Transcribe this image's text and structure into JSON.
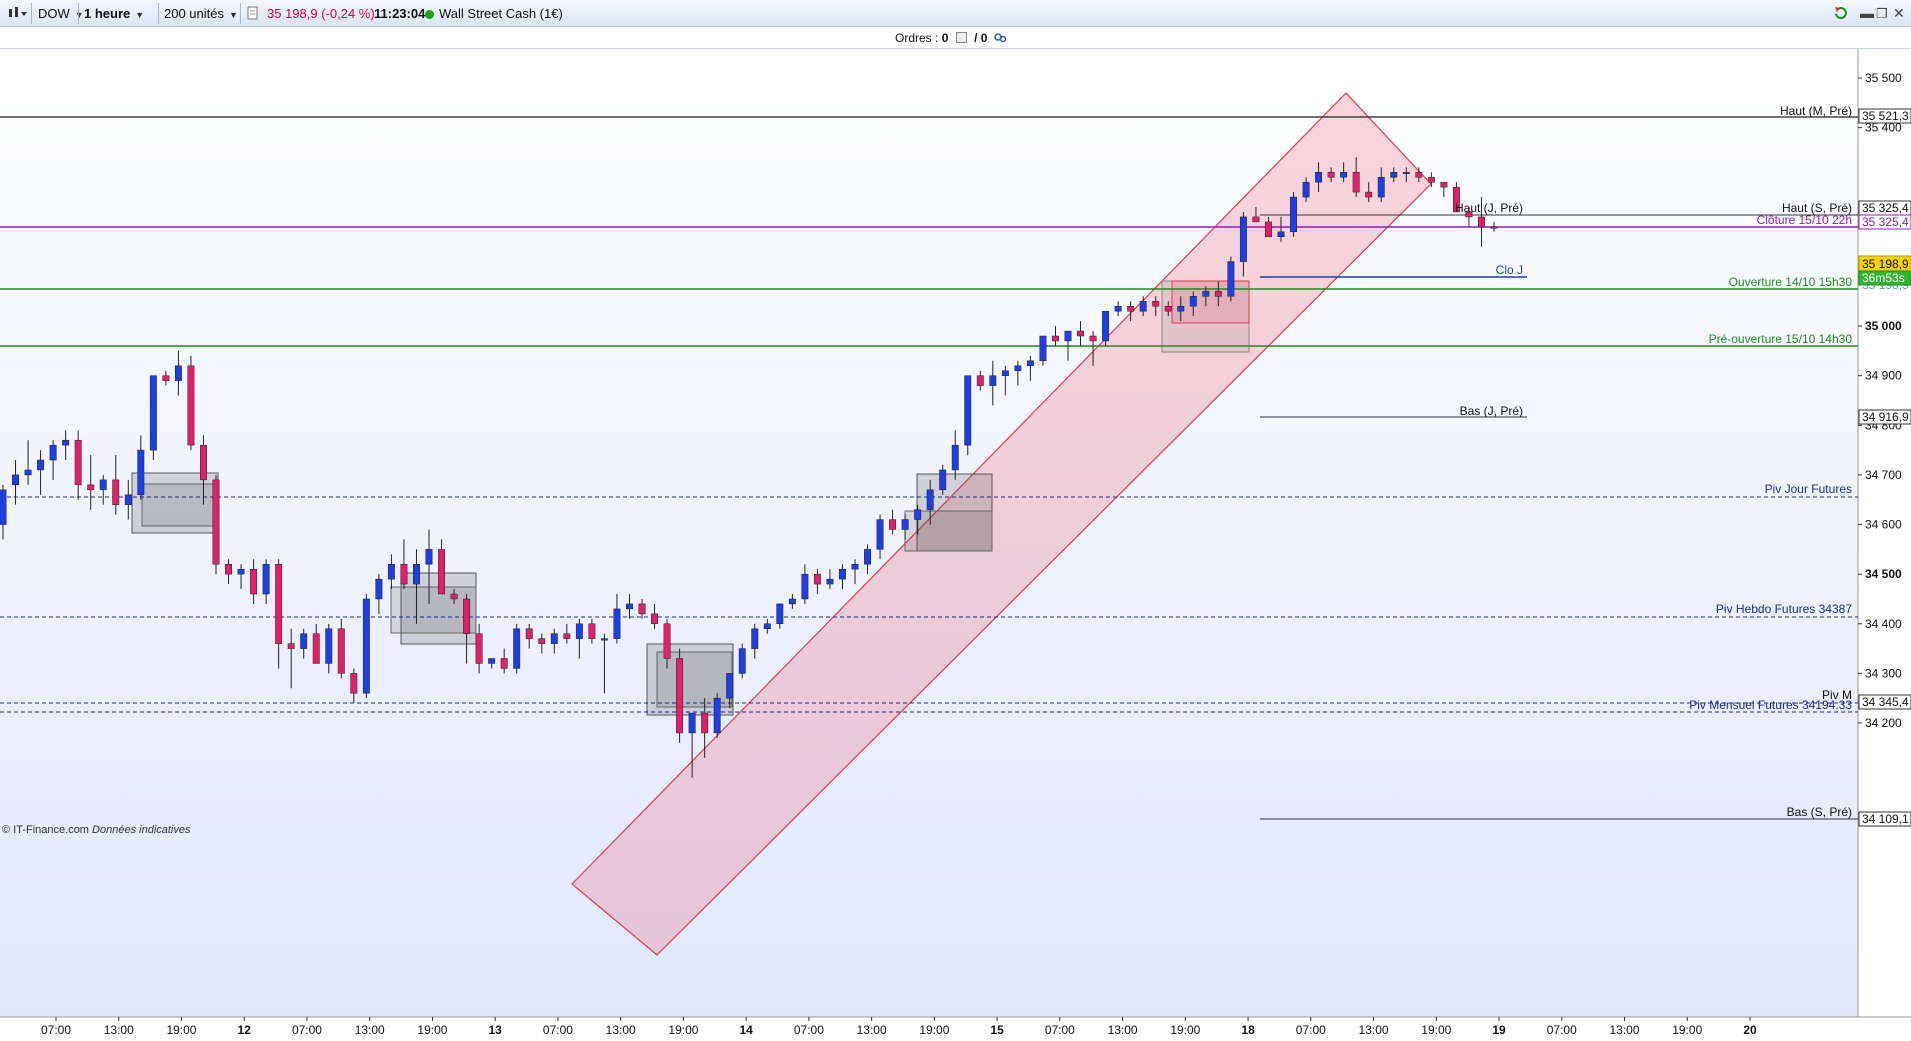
{
  "toolbar": {
    "symbol": "DOW",
    "interval": "1 heure",
    "units": "200 unités",
    "price_change": "35 198,9 (-0,24 %)",
    "time": "11:23:04",
    "instrument": "Wall Street Cash (1€)"
  },
  "orders": {
    "label": "Ordres :",
    "count1": "0",
    "sep": "/ 0"
  },
  "colors": {
    "up": "#1f3fe0",
    "down": "#e0216a",
    "channel": "#f06b7e",
    "purple": "#8b1fb0",
    "green": "#1d8a1d",
    "navy": "#1f2a8c"
  },
  "levels": {
    "haut_m": {
      "label": "Haut (M, Pré)",
      "value": "35 521,3"
    },
    "haut_s": {
      "label": "Haut (S, Pré)",
      "value": "35 325,4"
    },
    "haut_j": {
      "label": "Haut (J, Pré)"
    },
    "cloture": {
      "label": "Clôture 15/10 22h",
      "value": "35 325,4"
    },
    "current": {
      "value": "35 198,9",
      "timer": "36m53s",
      "hidden": "35 198,9"
    },
    "clo_j": {
      "label": "Clo J"
    },
    "ouverture": {
      "label": "Ouverture 14/10 15h30"
    },
    "pre_ouverture": {
      "label": "Pré-ouverture 15/10 14h30"
    },
    "bas_j": {
      "label": "Bas (J, Pré)",
      "value": "34 916,9"
    },
    "piv_jour": {
      "label": "Piv Jour Futures"
    },
    "piv_hebdo": {
      "label": "Piv Hebdo Futures 34387"
    },
    "piv_m": {
      "label": "Piv M",
      "value": "34 345,4"
    },
    "piv_mensuel": {
      "label": "Piv Mensuel Futures 34194.33"
    },
    "bas_s": {
      "label": "Bas (S, Pré)",
      "value": "34 109,1"
    }
  },
  "price_axis": [
    "35 500",
    "35 400",
    "35 100",
    "35 000",
    "34 900",
    "34 800",
    "34 700",
    "34 600",
    "34 500",
    "34 400",
    "34 300",
    "34 200"
  ],
  "time_axis": [
    "07:00",
    "13:00",
    "19:00",
    "12",
    "07:00",
    "13:00",
    "19:00",
    "13",
    "07:00",
    "13:00",
    "19:00",
    "14",
    "07:00",
    "13:00",
    "19:00",
    "15",
    "07:00",
    "13:00",
    "19:00",
    "18",
    "07:00",
    "13:00",
    "19:00",
    "19",
    "07:00",
    "13:00",
    "19:00",
    "20"
  ],
  "footer": {
    "brand": "IT-Finance.com",
    "note": "Données indicatives"
  },
  "chart_data": {
    "type": "candlestick",
    "interval": "1 heure",
    "ohlc": [
      [
        34600,
        34680,
        34570,
        34670
      ],
      [
        34680,
        34730,
        34640,
        34700
      ],
      [
        34700,
        34770,
        34680,
        34710
      ],
      [
        34710,
        34750,
        34660,
        34730
      ],
      [
        34730,
        34770,
        34690,
        34760
      ],
      [
        34760,
        34790,
        34730,
        34770
      ],
      [
        34770,
        34790,
        34650,
        34680
      ],
      [
        34680,
        34740,
        34630,
        34670
      ],
      [
        34670,
        34700,
        34640,
        34690
      ],
      [
        34690,
        34740,
        34620,
        34640
      ],
      [
        34640,
        34690,
        34610,
        34660
      ],
      [
        34660,
        34780,
        34650,
        34750
      ],
      [
        34750,
        34900,
        34730,
        34900
      ],
      [
        34900,
        34910,
        34880,
        34890
      ],
      [
        34890,
        34950,
        34860,
        34920
      ],
      [
        34920,
        34940,
        34750,
        34760
      ],
      [
        34760,
        34780,
        34640,
        34690
      ],
      [
        34690,
        34700,
        34500,
        34520
      ],
      [
        34520,
        34530,
        34480,
        34500
      ],
      [
        34500,
        34520,
        34470,
        34510
      ],
      [
        34510,
        34530,
        34440,
        34460
      ],
      [
        34460,
        34530,
        34440,
        34520
      ],
      [
        34520,
        34530,
        34310,
        34360
      ],
      [
        34360,
        34390,
        34270,
        34350
      ],
      [
        34350,
        34390,
        34330,
        34380
      ],
      [
        34380,
        34400,
        34330,
        34320
      ],
      [
        34320,
        34400,
        34300,
        34390
      ],
      [
        34390,
        34410,
        34290,
        34300
      ],
      [
        34300,
        34310,
        34240,
        34260
      ],
      [
        34260,
        34460,
        34250,
        34450
      ],
      [
        34450,
        34500,
        34420,
        34490
      ],
      [
        34490,
        34540,
        34470,
        34520
      ],
      [
        34520,
        34570,
        34470,
        34480
      ],
      [
        34480,
        34550,
        34400,
        34520
      ],
      [
        34520,
        34590,
        34440,
        34550
      ],
      [
        34550,
        34570,
        34480,
        34460
      ],
      [
        34460,
        34470,
        34440,
        34450
      ],
      [
        34450,
        34460,
        34320,
        34380
      ],
      [
        34380,
        34400,
        34300,
        34320
      ],
      [
        34320,
        34330,
        34310,
        34330
      ],
      [
        34330,
        34350,
        34300,
        34310
      ],
      [
        34310,
        34400,
        34300,
        34390
      ],
      [
        34390,
        34400,
        34350,
        34370
      ],
      [
        34370,
        34380,
        34340,
        34360
      ],
      [
        34360,
        34390,
        34340,
        34380
      ],
      [
        34380,
        34400,
        34360,
        34370
      ],
      [
        34370,
        34410,
        34330,
        34400
      ],
      [
        34400,
        34410,
        34360,
        34370
      ],
      [
        34370,
        34380,
        34260,
        34370
      ],
      [
        34370,
        34460,
        34360,
        34430
      ],
      [
        34430,
        34460,
        34410,
        34440
      ],
      [
        34440,
        34450,
        34410,
        34420
      ],
      [
        34420,
        34440,
        34390,
        34400
      ],
      [
        34400,
        34410,
        34310,
        34330
      ],
      [
        34330,
        34350,
        34160,
        34180
      ],
      [
        34180,
        34220,
        34090,
        34220
      ],
      [
        34220,
        34250,
        34130,
        34180
      ],
      [
        34180,
        34260,
        34170,
        34250
      ],
      [
        34250,
        34300,
        34230,
        34300
      ],
      [
        34300,
        34360,
        34290,
        34350
      ],
      [
        34350,
        34400,
        34330,
        34390
      ],
      [
        34390,
        34410,
        34380,
        34400
      ],
      [
        34400,
        34440,
        34390,
        34440
      ],
      [
        34440,
        34460,
        34430,
        34450
      ],
      [
        34450,
        34520,
        34440,
        34500
      ],
      [
        34500,
        34510,
        34460,
        34480
      ],
      [
        34480,
        34510,
        34470,
        34490
      ],
      [
        34490,
        34520,
        34470,
        34510
      ],
      [
        34510,
        34530,
        34480,
        34520
      ],
      [
        34520,
        34560,
        34500,
        34550
      ],
      [
        34550,
        34620,
        34530,
        34610
      ],
      [
        34610,
        34630,
        34580,
        34590
      ],
      [
        34590,
        34620,
        34570,
        34610
      ],
      [
        34610,
        34640,
        34580,
        34630
      ],
      [
        34630,
        34690,
        34600,
        34670
      ],
      [
        34670,
        34720,
        34660,
        34710
      ],
      [
        34710,
        34790,
        34690,
        34760
      ],
      [
        34760,
        34900,
        34740,
        34900
      ],
      [
        34900,
        34910,
        34870,
        34880
      ],
      [
        34880,
        34930,
        34840,
        34900
      ],
      [
        34900,
        34920,
        34860,
        34910
      ],
      [
        34910,
        34930,
        34880,
        34920
      ],
      [
        34920,
        34940,
        34890,
        34930
      ],
      [
        34930,
        34980,
        34920,
        34980
      ],
      [
        34980,
        35000,
        34960,
        34970
      ],
      [
        34970,
        34980,
        34930,
        34990
      ],
      [
        34990,
        35010,
        34960,
        34980
      ],
      [
        34980,
        34990,
        34920,
        34970
      ],
      [
        34970,
        35030,
        34960,
        35030
      ],
      [
        35030,
        35050,
        35020,
        35040
      ],
      [
        35040,
        35050,
        35010,
        35030
      ],
      [
        35030,
        35060,
        35020,
        35050
      ],
      [
        35050,
        35060,
        35020,
        35040
      ],
      [
        35040,
        35050,
        35020,
        35030
      ],
      [
        35030,
        35060,
        35010,
        35040
      ],
      [
        35040,
        35070,
        35020,
        35060
      ],
      [
        35060,
        35080,
        35040,
        35070
      ],
      [
        35070,
        35090,
        35040,
        35060
      ],
      [
        35060,
        35140,
        35050,
        35130
      ],
      [
        35130,
        35230,
        35100,
        35220
      ],
      [
        35220,
        35240,
        35210,
        35210
      ],
      [
        35210,
        35220,
        35190,
        35180
      ],
      [
        35180,
        35220,
        35170,
        35190
      ],
      [
        35190,
        35270,
        35180,
        35260
      ],
      [
        35260,
        35300,
        35250,
        35290
      ],
      [
        35290,
        35330,
        35270,
        35310
      ],
      [
        35310,
        35320,
        35290,
        35300
      ],
      [
        35300,
        35330,
        35290,
        35310
      ],
      [
        35310,
        35340,
        35260,
        35270
      ],
      [
        35270,
        35290,
        35250,
        35260
      ],
      [
        35260,
        35320,
        35250,
        35300
      ],
      [
        35300,
        35320,
        35290,
        35310
      ],
      [
        35310,
        35320,
        35290,
        35310
      ],
      [
        35310,
        35320,
        35290,
        35300
      ],
      [
        35300,
        35310,
        35280,
        35290
      ],
      [
        35290,
        35290,
        35260,
        35280
      ],
      [
        35280,
        35290,
        35230,
        35230
      ],
      [
        35230,
        35240,
        35200,
        35220
      ],
      [
        35220,
        35260,
        35160,
        35200
      ],
      [
        35200,
        35210,
        35190,
        35198.9
      ]
    ],
    "price_range": [
      34050,
      35530
    ]
  }
}
